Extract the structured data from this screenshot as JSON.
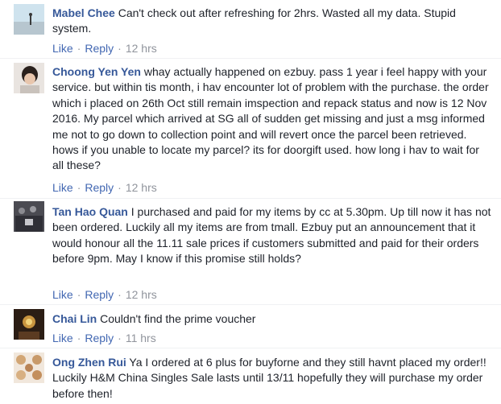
{
  "comments": [
    {
      "author": "Mabel Chee",
      "text": "Can't check out after refreshing for 2hrs. Wasted all my data. Stupid system.",
      "like_label": "Like",
      "reply_label": "Reply",
      "separator": "·",
      "time": "12 hrs"
    },
    {
      "author": "Choong Yen Yen",
      "text": "whay actually happened on ezbuy. pass 1 year i feel happy with your service. but within tis month, i hav encounter lot of problem with the purchase. the order which i placed on 26th Oct still remain imspection and repack status and now is 12 Nov 2016. My parcel which arrived at SG all of sudden get missing and just a msg informed me not to go down to collection point and will revert once the parcel been retrieved. hows if you unable to locate my parcel? its for doorgift used. how long i hav to wait for all these?",
      "like_label": "Like",
      "reply_label": "Reply",
      "separator": "·",
      "time": "12 hrs"
    },
    {
      "author": "Tan Hao Quan",
      "text": "I purchased and paid for my items by cc at 5.30pm. Up till now it has not been ordered. Luckily all my items are from tmall. Ezbuy put an announcement that it would honour all the 11.11 sale prices if customers submitted and paid for their orders before 9pm. May I know if this promise still holds?",
      "like_label": "Like",
      "reply_label": "Reply",
      "separator": "·",
      "time": "12 hrs"
    },
    {
      "author": "Chai Lin",
      "text": "Couldn't find the prime voucher",
      "like_label": "Like",
      "reply_label": "Reply",
      "separator": "·",
      "time": "11 hrs"
    },
    {
      "author": "Ong Zhen Rui",
      "text": "Ya I ordered at 6 plus for buyforne and they still havnt placed my order!! Luckily H&M China Singles Sale lasts until 13/11 hopefully they will purchase my order before then!",
      "like_label": "Like",
      "reply_label": "Reply",
      "separator": "·",
      "time": ""
    }
  ]
}
